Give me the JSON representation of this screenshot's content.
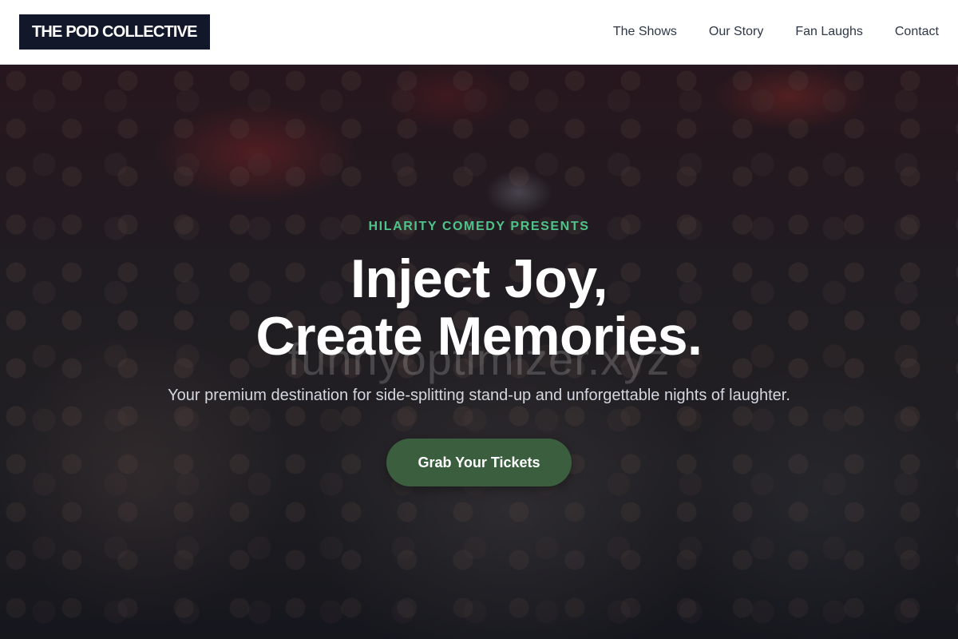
{
  "header": {
    "logo_text": "THE POD COLLECTIVE",
    "nav": [
      {
        "label": "The Shows"
      },
      {
        "label": "Our Story"
      },
      {
        "label": "Fan Laughs"
      },
      {
        "label": "Contact"
      }
    ]
  },
  "hero": {
    "eyebrow": "HILARITY COMEDY PRESENTS",
    "headline_line1": "Inject Joy,",
    "headline_line2": "Create Memories.",
    "watermark": "funnyoptimizer.xyz",
    "subtitle": "Your premium destination for side-splitting stand-up and unforgettable nights of laughter.",
    "cta_label": "Grab Your Tickets"
  },
  "colors": {
    "logo_bg": "#121729",
    "accent_green": "#4fc48a",
    "cta_bg": "#3b5e3f",
    "nav_text": "#2d3748"
  }
}
